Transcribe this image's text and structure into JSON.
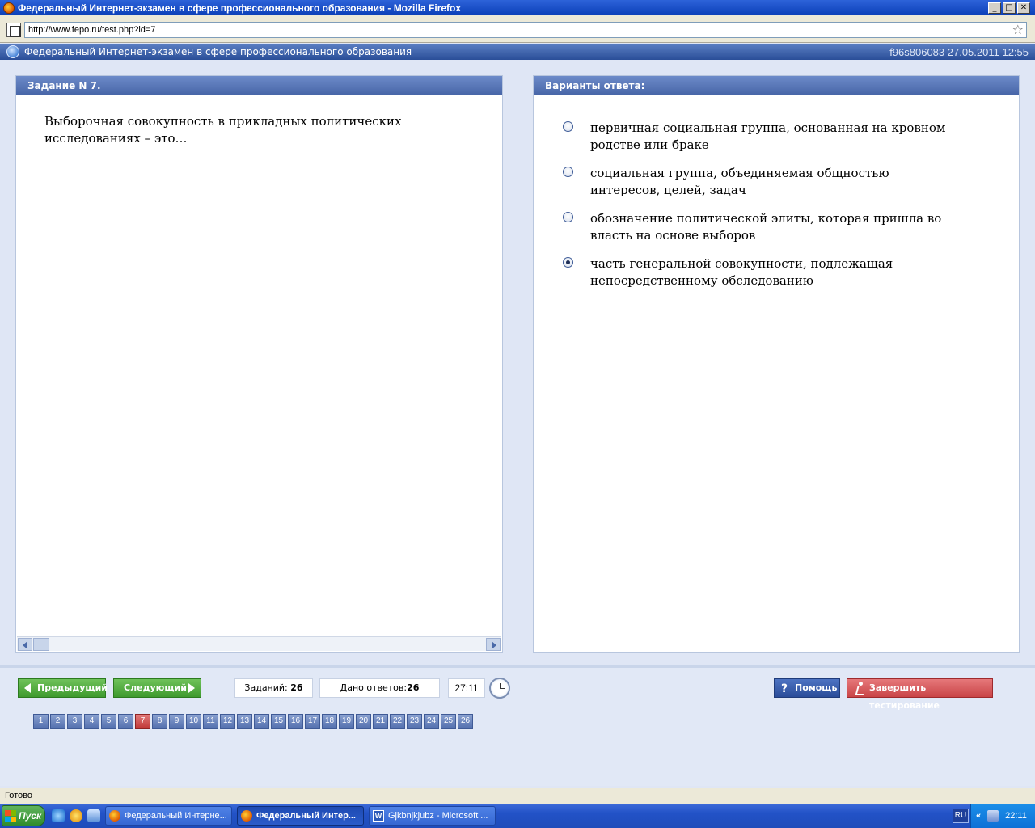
{
  "window": {
    "title": "Федеральный Интернет-экзамен в сфере профессионального образования - Mozilla Firefox",
    "minimize": "_",
    "maximize": "□",
    "close": "✕"
  },
  "browser": {
    "url": "http://www.fepo.ru/test.php?id=7"
  },
  "app_header": {
    "title": "Федеральный Интернет-экзамен в сфере профессионального образования",
    "session": "f96s806083 27.05.2011 12:55"
  },
  "task": {
    "header": "Задание N 7.",
    "question": "Выборочная совокупность в прикладных политических исследованиях – это…"
  },
  "answers": {
    "header": "Варианты ответа:",
    "options": [
      {
        "text": "первичная социальная группа, основанная на кровном родстве или браке",
        "checked": false
      },
      {
        "text": "социальная группа, объединяемая общностью интересов, целей, задач",
        "checked": false
      },
      {
        "text": "обозначение политической элиты, которая пришла во власть на основе выборов",
        "checked": false
      },
      {
        "text": "часть генеральной совокупности, подлежащая непосредственному обследованию",
        "checked": true
      }
    ]
  },
  "navigation": {
    "prev_label": "Предыдущий",
    "next_label": "Следующий",
    "tasks_label": "Заданий:",
    "tasks_count": "26",
    "answers_label": "Дано ответов:",
    "answers_count": "26",
    "timer": "27:11",
    "help_label": "Помощь",
    "finish_label": "Завершить тестирование",
    "current_page": 7,
    "pages": [
      "1",
      "2",
      "3",
      "4",
      "5",
      "6",
      "7",
      "8",
      "9",
      "10",
      "11",
      "12",
      "13",
      "14",
      "15",
      "16",
      "17",
      "18",
      "19",
      "20",
      "21",
      "22",
      "23",
      "24",
      "25",
      "26"
    ]
  },
  "statusbar": {
    "text": "Готово"
  },
  "taskbar": {
    "start_label": "Пуск",
    "tasks": [
      {
        "label": "Федеральный Интерне...",
        "icon": "firefox-icon",
        "active": false
      },
      {
        "label": "Федеральный Интер...",
        "icon": "firefox-icon",
        "active": true
      },
      {
        "label": "Gjkbnjkjubz - Microsoft ...",
        "icon": "word-icon",
        "active": false
      }
    ],
    "language": "RU",
    "tray_chevron": "«",
    "clock": "22:11"
  },
  "colors": {
    "accent_blue": "#4866a8",
    "current_page": "#c23b3b",
    "green_button": "#3e9a2e",
    "finish_button": "#c94447"
  }
}
